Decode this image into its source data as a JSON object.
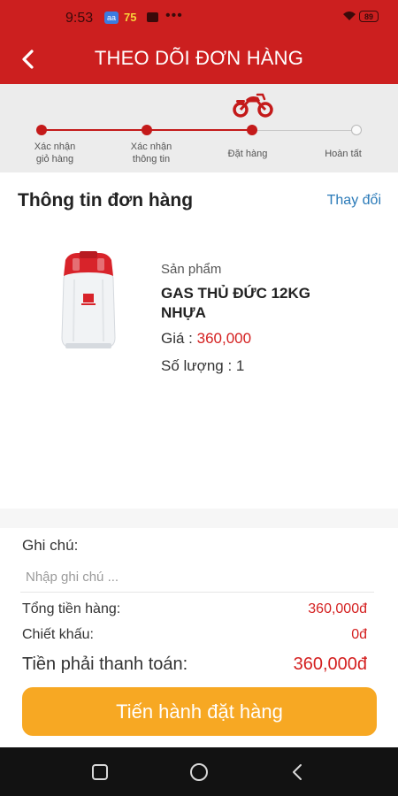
{
  "status_bar": {
    "time": "9:53",
    "app_icon_text": "aa",
    "notification_count": "75",
    "more_indicator": "•••",
    "battery_level": "89"
  },
  "header": {
    "title": "THEO DÕI ĐƠN HÀNG",
    "back_icon": "chevron-left-icon",
    "background_color": "#cc1f1f"
  },
  "stepper": {
    "current_step_index": 2,
    "active_color": "#c41a1a",
    "current_step_icon": "motorcycle-icon",
    "steps": [
      {
        "label_line1": "Xác nhận",
        "label_line2": "giỏ hàng",
        "state": "done"
      },
      {
        "label_line1": "Xác nhận",
        "label_line2": "thông tin",
        "state": "done"
      },
      {
        "label_line1": "Đặt hàng",
        "label_line2": "",
        "state": "current"
      },
      {
        "label_line1": "Hoàn tất",
        "label_line2": "",
        "state": "pending"
      }
    ]
  },
  "order_info": {
    "title": "Thông tin đơn hàng",
    "change_link": "Thay đổi",
    "product": {
      "caption": "Sản phẩm",
      "name": "GAS THỦ ĐỨC 12KG NHỰA",
      "price_label": "Giá :",
      "price_value": "360,000",
      "quantity_label": "Số lượng :",
      "quantity_value": "1"
    }
  },
  "summary": {
    "note_label": "Ghi chú:",
    "note_placeholder": "Nhập ghi chú ...",
    "note_value": "",
    "subtotal_label": "Tổng tiền hàng:",
    "subtotal_value": "360,000đ",
    "discount_label": "Chiết khấu:",
    "discount_value": "0đ",
    "total_label": "Tiền phải thanh toán:",
    "total_value": "360,000đ",
    "submit_label": "Tiến hành đặt hàng",
    "accent_color": "#f7a823"
  },
  "nav_bar": {
    "icons": [
      "recents-square-icon",
      "home-circle-icon",
      "back-triangle-icon"
    ]
  }
}
